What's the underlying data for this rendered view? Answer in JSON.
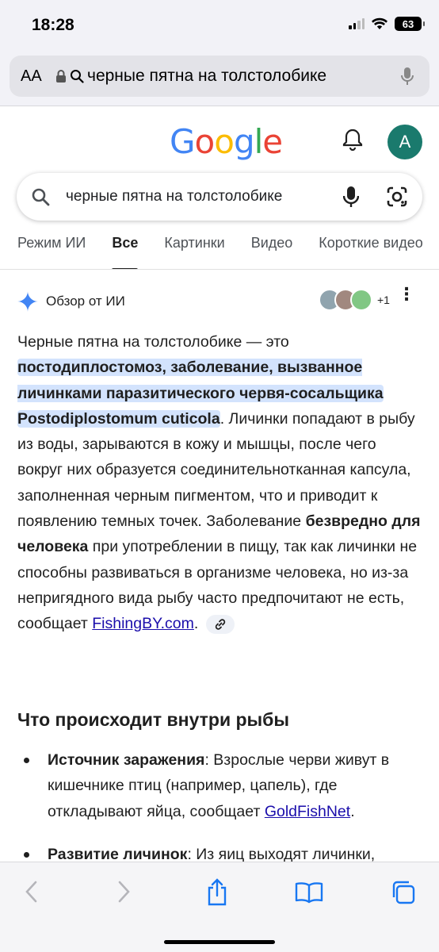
{
  "status": {
    "time": "18:28",
    "battery": "63"
  },
  "address_bar": {
    "aa_label": "AA",
    "url_text": "черные пятна на толстолобике"
  },
  "google": {
    "logo": [
      "G",
      "o",
      "o",
      "g",
      "l",
      "e"
    ],
    "logo_colors": [
      "#4285F4",
      "#EA4335",
      "#FBBC05",
      "#4285F4",
      "#34A853",
      "#EA4335"
    ],
    "avatar_letter": "A",
    "avatar_color": "#1a7a6d"
  },
  "search": {
    "query": "черные пятна на толстолобике"
  },
  "tabs": [
    {
      "label": "Режим ИИ",
      "active": false
    },
    {
      "label": "Все",
      "active": true
    },
    {
      "label": "Картинки",
      "active": false
    },
    {
      "label": "Видео",
      "active": false
    },
    {
      "label": "Короткие видео",
      "active": false
    }
  ],
  "ai_overview": {
    "title": "Обзор от ИИ",
    "sources_more": "+1",
    "p_intro": "Черные пятна на толстолобике — это ",
    "p_hl1": "постодиплостомоз, заболевание, вызванное личинками паразитического червя-сосальщика ",
    "p_hl2": "Postodiplostomum cuticola",
    "p_mid": ". Личинки попадают в рыбу из воды, зарываются в кожу и мышцы, после чего вокруг них образуется соединительнотканная капсула, заполненная черным пигментом, что и приводит к появлению темных точек. Заболевание ",
    "p_bold": "безвредно для человека",
    "p_end": " при употреблении в пищу, так как личинки не способны развиваться в организме человека, но из-за непригядного вида рыбу часто предпочитают не есть, сообщает ",
    "p_link": "FishingBY.com",
    "p_dot": "."
  },
  "section": {
    "title": "Что происходит внутри рыбы"
  },
  "bullets": [
    {
      "bold": "Источник заражения",
      "text": ": Взрослые черви живут в кишечнике птиц (например, цапель), где откладывают яйца, сообщает ",
      "link": "GoldFishNet",
      "tail": "."
    },
    {
      "bold": "Развитие личинок",
      "text": ": Из яиц выходят личинки,",
      "link": "",
      "tail": ""
    }
  ]
}
